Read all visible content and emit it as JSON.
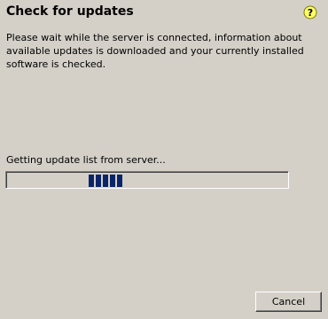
{
  "dialog": {
    "title": "Check for updates",
    "description": "Please wait while the server is connected, information about available updates is downloaded and your currently installed software is checked.",
    "status_text": "Getting update list from server...",
    "cancel_label": "Cancel"
  },
  "progress": {
    "mode": "indeterminate",
    "segments": 5,
    "bar_color": "#0a246a"
  },
  "icons": {
    "help": "help-question-icon"
  },
  "colors": {
    "background": "#d4d0c8",
    "help_icon_fill": "#ffff66"
  }
}
